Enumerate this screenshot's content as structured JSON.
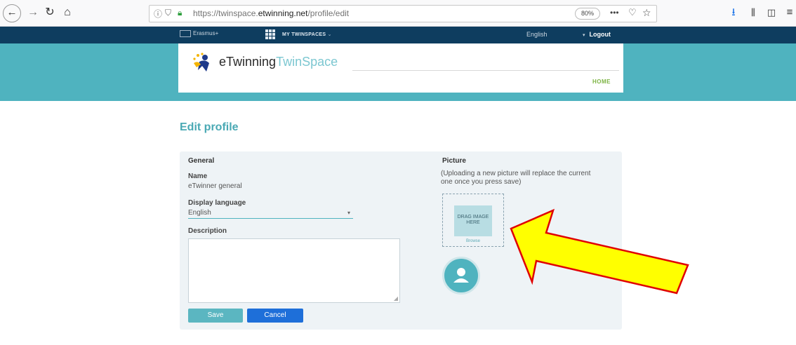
{
  "browser": {
    "url_prefix": "https://twinspace.",
    "url_domain": "etwinning.net",
    "url_path": "/profile/edit",
    "zoom": "80%"
  },
  "topbar": {
    "erasmus": "Erasmus+",
    "my_twinspaces": "MY TWINSPACES",
    "language": "English",
    "logout": "Logout"
  },
  "header": {
    "logo_e": "eTwinning",
    "logo_tw": "TwinSpace",
    "home": "HOME"
  },
  "page": {
    "title": "Edit profile"
  },
  "general": {
    "heading": "General",
    "name_label": "Name",
    "name_value": "eTwinner general",
    "display_language_label": "Display language",
    "display_language_value": "English",
    "description_label": "Description",
    "save": "Save",
    "cancel": "Cancel"
  },
  "picture": {
    "heading": "Picture",
    "note": "(Uploading a new picture will replace the current one once you press save)",
    "drag_text": "DRAG IMAGE HERE",
    "browse": "Browse"
  },
  "colors": {
    "topbar": "#0e3d5f",
    "teal": "#4fb3bf",
    "title": "#4aa9b4",
    "save": "#5bb6c1",
    "cancel": "#1e6fd9",
    "arrow_fill": "#ffff00",
    "arrow_stroke": "#e00000"
  },
  "icons": [
    "back-arrow-icon",
    "forward-arrow-icon",
    "reload-icon",
    "home-icon",
    "info-icon",
    "shield-icon",
    "lock-icon",
    "more-icon",
    "pocket-icon",
    "star-icon",
    "download-icon",
    "library-icon",
    "sidebar-icon",
    "menu-icon",
    "apps-grid-icon",
    "user-avatar-icon",
    "annotation-arrow"
  ]
}
